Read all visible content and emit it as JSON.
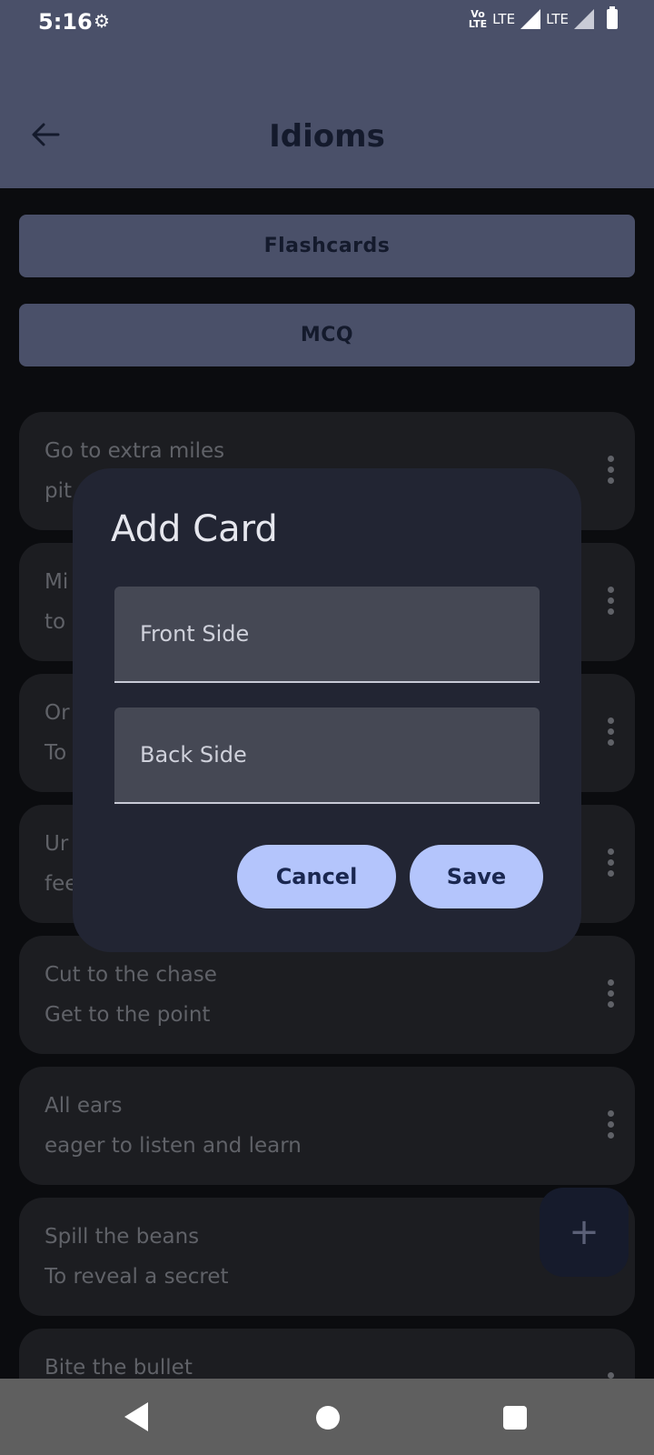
{
  "status": {
    "time": "5:16",
    "gear_icon": "⚙",
    "volte_top": "Vo",
    "volte_bottom": "LTE",
    "lte1": "LTE",
    "lte2": "LTE"
  },
  "header": {
    "title": "Idioms"
  },
  "actions": {
    "flashcards": "Flashcards",
    "mcq": "MCQ"
  },
  "cards": [
    {
      "front": "Go to extra miles",
      "back": "pit"
    },
    {
      "front": "Mi",
      "back": "to"
    },
    {
      "front": "Or",
      "back": "To"
    },
    {
      "front": "Ur",
      "back": "fee"
    },
    {
      "front": "Cut to the chase",
      "back": "Get to the point"
    },
    {
      "front": "All ears",
      "back": "eager to listen and learn"
    },
    {
      "front": "Spill the beans",
      "back": "To reveal a secret"
    },
    {
      "front": "Bite the bullet",
      "back": ""
    }
  ],
  "fab": {
    "label": "+"
  },
  "dialog": {
    "title": "Add Card",
    "front_placeholder": "Front Side",
    "back_placeholder": "Back Side",
    "cancel": "Cancel",
    "save": "Save"
  }
}
